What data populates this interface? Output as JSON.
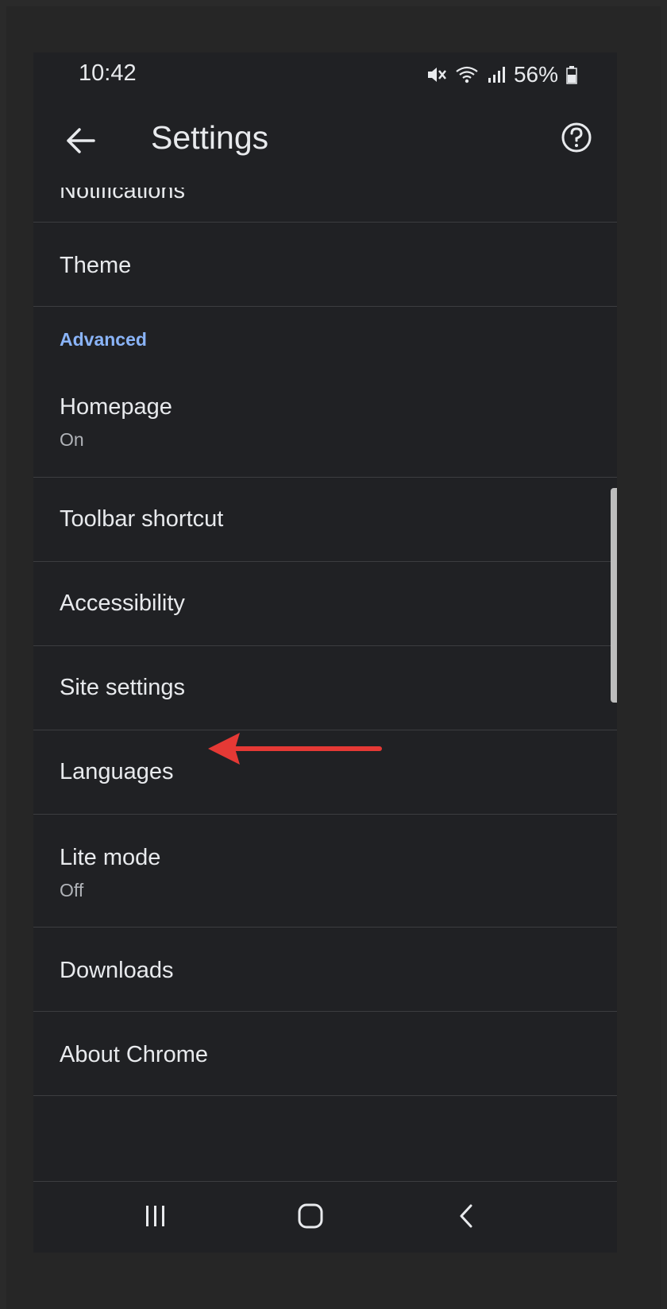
{
  "status_bar": {
    "time": "10:42",
    "battery_text": "56%",
    "icons": [
      "mute-icon",
      "wifi-icon",
      "signal-icon",
      "battery-icon"
    ]
  },
  "app_bar": {
    "title": "Settings",
    "back_icon": "arrow-left-icon",
    "help_icon": "help-circle-icon"
  },
  "settings_list": {
    "items": [
      {
        "title": "Notifications"
      },
      {
        "title": "Theme"
      }
    ],
    "section_header": "Advanced",
    "advanced_items": [
      {
        "title": "Homepage",
        "subtitle": "On"
      },
      {
        "title": "Toolbar shortcut"
      },
      {
        "title": "Accessibility"
      },
      {
        "title": "Site settings"
      },
      {
        "title": "Languages"
      },
      {
        "title": "Lite mode",
        "subtitle": "Off"
      },
      {
        "title": "Downloads"
      },
      {
        "title": "About Chrome"
      }
    ]
  },
  "nav_bar": {
    "icons": [
      "recents-icon",
      "home-icon",
      "back-icon"
    ]
  },
  "colors": {
    "background": "#202124",
    "text": "#e8eaed",
    "accent": "#8ab4f8",
    "annotation_arrow": "#e53935"
  }
}
